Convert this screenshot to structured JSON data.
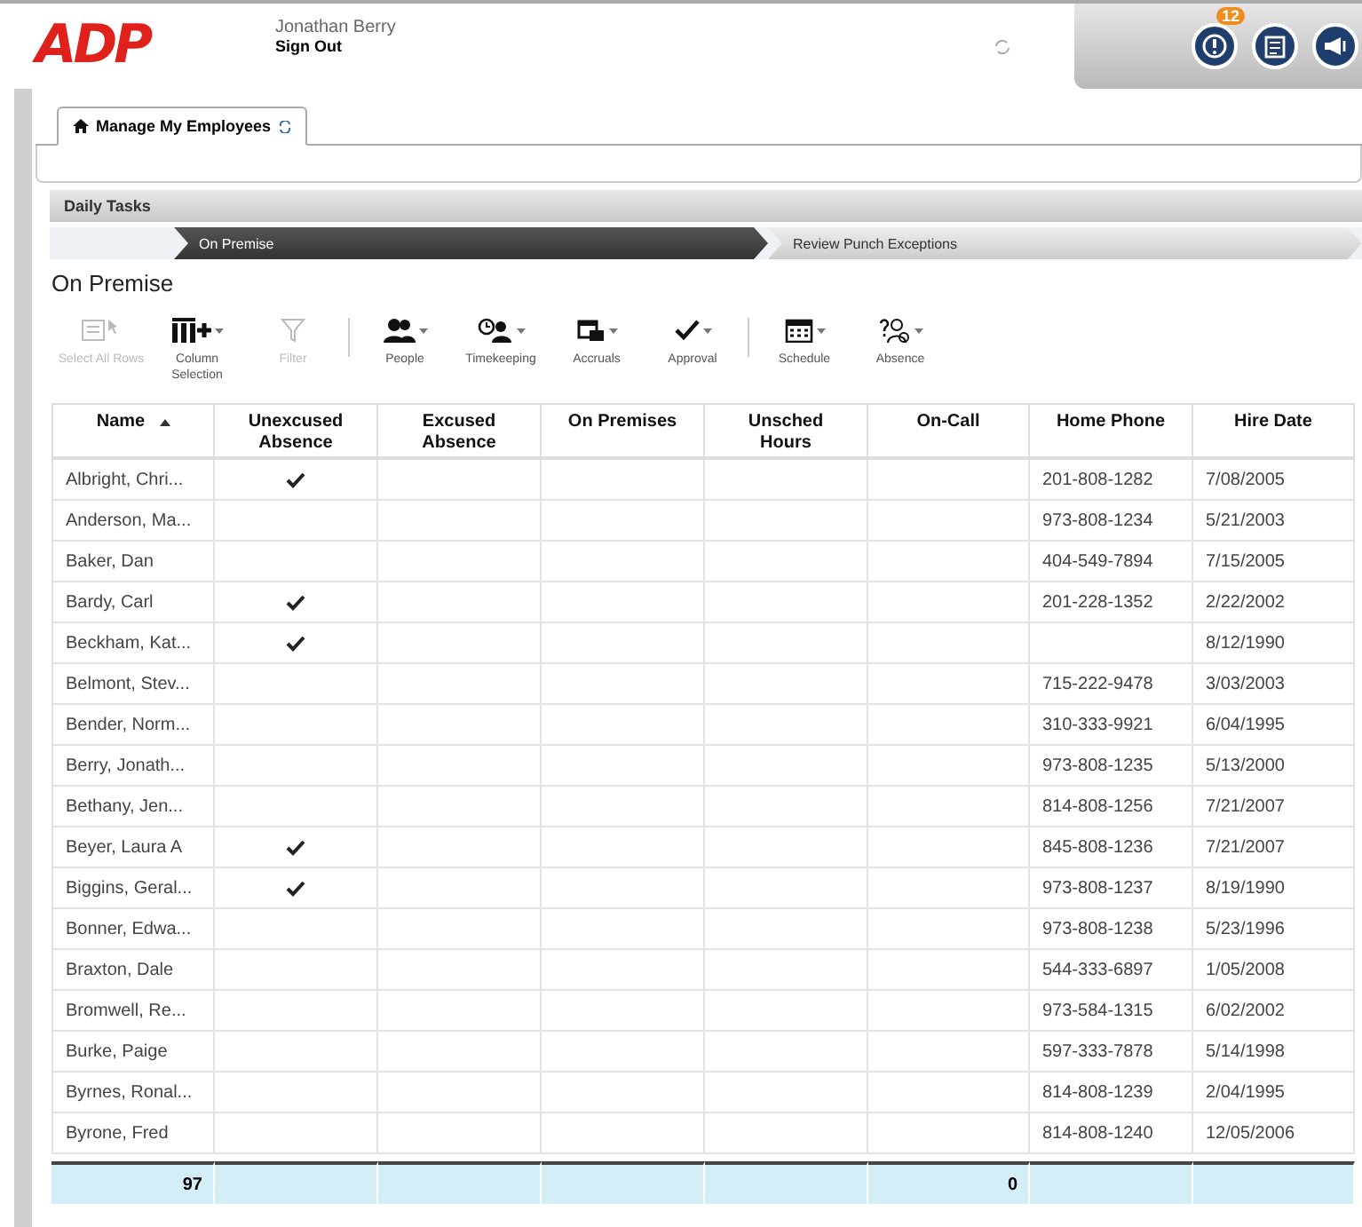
{
  "header": {
    "logo": "ADP",
    "user_name": "Jonathan Berry",
    "sign_out": "Sign Out",
    "alert_count": "12"
  },
  "tabs": [
    {
      "label": "Manage My Employees",
      "selected": true
    }
  ],
  "section": {
    "title": "Daily Tasks"
  },
  "steps": [
    {
      "label": "On Premise",
      "selected": true
    },
    {
      "label": "Review Punch Exceptions",
      "selected": false
    }
  ],
  "page_title": "On Premise",
  "toolbar": [
    [
      {
        "label": "Select All Rows",
        "kind": "select",
        "disabled": true,
        "menu": false
      },
      {
        "label": "Column Selection",
        "kind": "columns",
        "disabled": false,
        "menu": true
      },
      {
        "label": "Filter",
        "kind": "filter",
        "disabled": true,
        "menu": false
      }
    ],
    [
      {
        "label": "People",
        "kind": "people",
        "disabled": false,
        "menu": true
      },
      {
        "label": "Timekeeping",
        "kind": "clock",
        "disabled": false,
        "menu": true
      },
      {
        "label": "Accruals",
        "kind": "accruals",
        "disabled": false,
        "menu": true
      },
      {
        "label": "Approval",
        "kind": "check",
        "disabled": false,
        "menu": true
      }
    ],
    [
      {
        "label": "Schedule",
        "kind": "calendar",
        "disabled": false,
        "menu": true
      },
      {
        "label": "Absence",
        "kind": "absence",
        "disabled": false,
        "menu": true
      }
    ]
  ],
  "table": {
    "columns": [
      {
        "label": "Name",
        "sorted": true
      },
      {
        "label": "Unexcused Absence",
        "sorted": false
      },
      {
        "label": "Excused Absence",
        "sorted": false
      },
      {
        "label": "On Premises",
        "sorted": false
      },
      {
        "label": "Unsched Hours",
        "sorted": false
      },
      {
        "label": "On-Call",
        "sorted": false
      },
      {
        "label": "Home Phone",
        "sorted": false
      },
      {
        "label": "Hire Date",
        "sorted": false
      }
    ],
    "rows": [
      {
        "name": "Albright, Chri...",
        "unexcused": true,
        "phone": "201-808-1282",
        "hire_date": "7/08/2005"
      },
      {
        "name": "Anderson, Ma...",
        "unexcused": false,
        "phone": "973-808-1234",
        "hire_date": "5/21/2003"
      },
      {
        "name": "Baker, Dan",
        "unexcused": false,
        "phone": "404-549-7894",
        "hire_date": "7/15/2005"
      },
      {
        "name": "Bardy, Carl",
        "unexcused": true,
        "phone": "201-228-1352",
        "hire_date": "2/22/2002"
      },
      {
        "name": "Beckham, Kat...",
        "unexcused": true,
        "hire_date": "8/12/1990"
      },
      {
        "name": "Belmont, Stev...",
        "unexcused": false,
        "phone": "715-222-9478",
        "hire_date": "3/03/2003"
      },
      {
        "name": "Bender, Norm...",
        "unexcused": false,
        "phone": "310-333-9921",
        "hire_date": "6/04/1995"
      },
      {
        "name": "Berry, Jonath...",
        "unexcused": false,
        "phone": "973-808-1235",
        "hire_date": "5/13/2000"
      },
      {
        "name": "Bethany, Jen...",
        "unexcused": false,
        "phone": "814-808-1256",
        "hire_date": "7/21/2007"
      },
      {
        "name": "Beyer, Laura A",
        "unexcused": true,
        "phone": "845-808-1236",
        "hire_date": "7/21/2007"
      },
      {
        "name": "Biggins, Geral...",
        "unexcused": true,
        "phone": "973-808-1237",
        "hire_date": "8/19/1990"
      },
      {
        "name": "Bonner, Edwa...",
        "unexcused": false,
        "phone": "973-808-1238",
        "hire_date": "5/23/1996"
      },
      {
        "name": "Braxton, Dale",
        "unexcused": false,
        "phone": "544-333-6897",
        "hire_date": "1/05/2008"
      },
      {
        "name": "Bromwell, Re...",
        "unexcused": false,
        "phone": "973-584-1315",
        "hire_date": "6/02/2002"
      },
      {
        "name": "Burke, Paige",
        "unexcused": false,
        "phone": "597-333-7878",
        "hire_date": "5/14/1998"
      },
      {
        "name": "Byrnes, Ronal...",
        "unexcused": false,
        "phone": "814-808-1239",
        "hire_date": "2/04/1995"
      },
      {
        "name": "Byrone, Fred",
        "unexcused": false,
        "phone": "814-808-1240",
        "hire_date": "12/05/2006"
      }
    ],
    "totals": {
      "name": "97",
      "on_call": "0"
    }
  }
}
